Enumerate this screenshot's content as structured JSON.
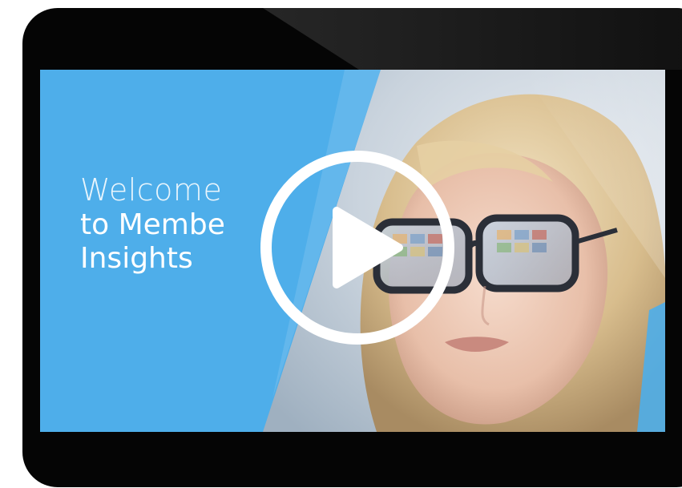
{
  "video": {
    "welcome_line": "Welcome",
    "title_line_1": "to Member Insights",
    "title_line_1_visible": "to Membe",
    "title_line_2": "Insights"
  },
  "controls": {
    "play_icon": "play-icon"
  },
  "colors": {
    "device_frame": "#050505",
    "screen_blue": "#4eaeea",
    "text": "#ffffff",
    "play_ring": "#ffffff"
  }
}
